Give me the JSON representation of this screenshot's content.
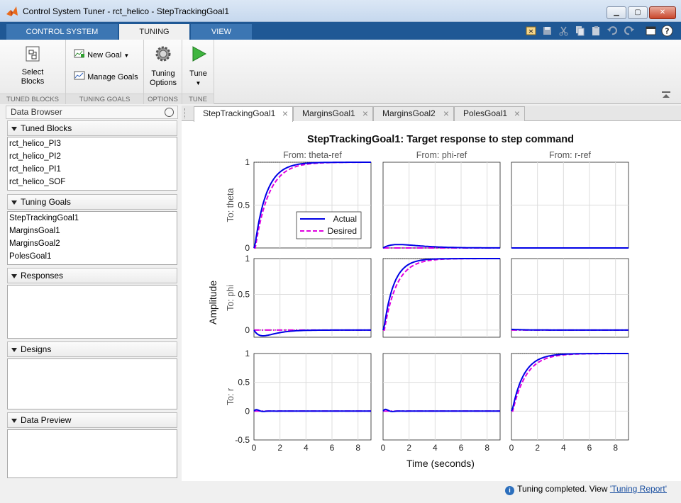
{
  "window": {
    "title": "Control System Tuner - rct_helico - StepTrackingGoal1",
    "min": "▁",
    "max": "▢",
    "close": "✕"
  },
  "ribbon_tabs": [
    "CONTROL SYSTEM",
    "TUNING",
    "VIEW"
  ],
  "ribbon": {
    "select_blocks": "Select Blocks",
    "new_goal": "New Goal",
    "manage_goals": "Manage Goals",
    "tuning_options": "Tuning Options",
    "tune": "Tune",
    "sections": [
      "TUNED BLOCKS",
      "TUNING GOALS",
      "OPTIONS",
      "TUNE"
    ]
  },
  "browser": {
    "title": "Data Browser",
    "tuned_blocks": {
      "label": "Tuned Blocks",
      "items": [
        "rct_helico_PI3",
        "rct_helico_PI2",
        "rct_helico_PI1",
        "rct_helico_SOF"
      ]
    },
    "tuning_goals": {
      "label": "Tuning Goals",
      "items": [
        "StepTrackingGoal1",
        "MarginsGoal1",
        "MarginsGoal2",
        "PolesGoal1"
      ]
    },
    "responses": {
      "label": "Responses"
    },
    "designs": {
      "label": "Designs"
    },
    "data_preview": {
      "label": "Data Preview"
    }
  },
  "doc_tabs": [
    "StepTrackingGoal1",
    "MarginsGoal1",
    "MarginsGoal2",
    "PolesGoal1"
  ],
  "status": {
    "text": "Tuning completed. View ",
    "link": "'Tuning Report'"
  },
  "colors": {
    "actual": "#0000e6",
    "desired": "#e000e0",
    "ribbon_blue": "#1f5895"
  },
  "chart_data": {
    "type": "line",
    "title": "StepTrackingGoal1: Target response to step command",
    "xlabel": "Time (seconds)",
    "ylabel": "Amplitude",
    "columns": [
      "From: theta-ref",
      "From: phi-ref",
      "From: r-ref"
    ],
    "rows": [
      "To: theta",
      "To: phi",
      "To: r"
    ],
    "xlim": [
      0,
      9
    ],
    "xticks": [
      0,
      2,
      4,
      6,
      8
    ],
    "ylim": [
      -0.5,
      1
    ],
    "yticks": [
      0,
      0.5,
      1
    ],
    "bottom_yticks": [
      -0.5,
      0,
      0.5,
      1
    ],
    "legend": {
      "placement": "inside row 1 col 1",
      "entries": [
        "Actual",
        "Desired"
      ]
    },
    "series": [
      {
        "name": "Actual",
        "style": "solid",
        "time_constant_diag": 0.9
      },
      {
        "name": "Desired",
        "style": "dashed",
        "time_constant_diag": 1.0
      }
    ],
    "grid": true
  }
}
